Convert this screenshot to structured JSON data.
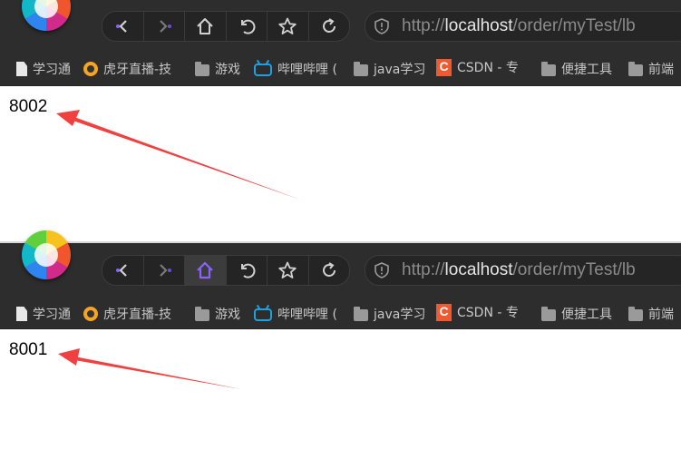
{
  "screenshots": [
    {
      "url": {
        "prefix": "http://",
        "host": "localhost",
        "path": "/order/myTest/lb"
      },
      "bookmarks": [
        "学习通",
        "虎牙直播-技",
        "游戏",
        "哔哩哔哩 (",
        "java学习",
        "CSDN - 专",
        "便捷工具",
        "前端"
      ],
      "response": "8002",
      "home_active": false
    },
    {
      "url": {
        "prefix": "http://",
        "host": "localhost",
        "path": "/order/myTest/lb"
      },
      "bookmarks": [
        "学习通",
        "虎牙直播-技",
        "游戏",
        "哔哩哔哩 (",
        "java学习",
        "CSDN - 专",
        "便捷工具",
        "前端"
      ],
      "response": "8001",
      "home_active": true
    }
  ],
  "icons": {
    "csdn_letter": "C",
    "back": "back-icon",
    "forward": "forward-icon",
    "home": "home-icon",
    "undo": "undo-icon",
    "favorite": "star-icon",
    "refresh": "refresh-icon",
    "security": "shield-icon"
  },
  "colors": {
    "toolbar": "#2d2d2d",
    "annotation_arrow": "#f04040",
    "home_active": "#8a63ff"
  }
}
